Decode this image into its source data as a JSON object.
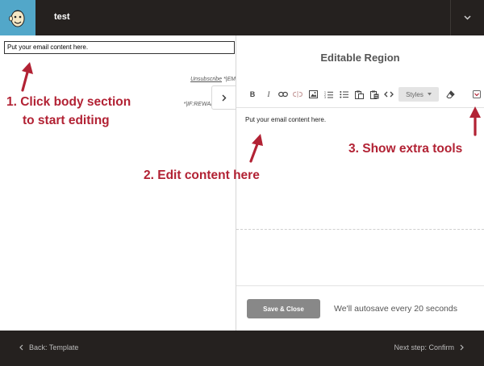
{
  "header": {
    "campaign_title": "test",
    "logo_icon": "mailchimp-freddie-icon",
    "menu_icon": "chevron-down-icon"
  },
  "preview": {
    "body_text": "Put your email content here.",
    "unsubscribe_link": "Unsubscribe",
    "unsubscribe_merge": " *|EM",
    "list_merge": "*|LIST:AD",
    "rewards_merge": "*|IF:REWARDS|* *|R",
    "toggle_icon": "chevron-right-icon"
  },
  "editor": {
    "title": "Editable Region",
    "toolbar": {
      "bold": "B",
      "italic": "I",
      "styles_label": "Styles",
      "icons": [
        "bold-icon",
        "italic-icon",
        "link-icon",
        "unlink-icon",
        "image-icon",
        "numbered-list-icon",
        "bulleted-list-icon",
        "paste-icon",
        "paste-text-icon",
        "source-code-icon",
        "styles-dropdown",
        "clear-format-icon",
        "extra-tools-icon"
      ]
    },
    "content_text": "Put your email content here.",
    "save_label": "Save & Close",
    "autosave_text": "We'll autosave every 20 seconds"
  },
  "footer": {
    "back_label": "Back: Template",
    "next_label": "Next step: Confirm"
  },
  "annotations": {
    "step1_line1": "1. Click body section",
    "step1_line2": "to start editing",
    "step2": "2. Edit content here",
    "step3": "3. Show extra tools"
  },
  "colors": {
    "topbar": "#25211f",
    "logo_bg": "#52a7c9",
    "annotation": "#b22234",
    "save_button": "#888888"
  }
}
